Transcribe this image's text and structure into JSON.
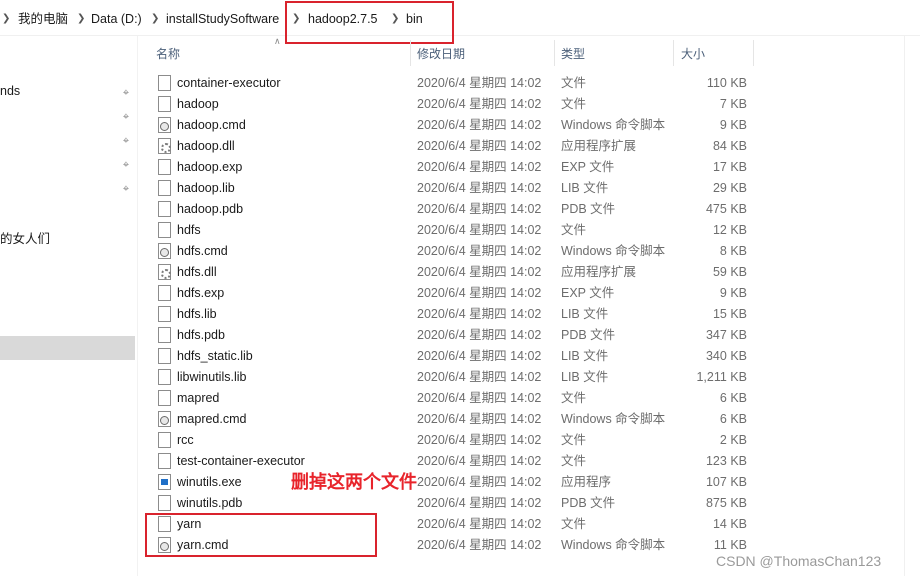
{
  "breadcrumb": [
    {
      "label": "我的电脑"
    },
    {
      "label": "Data (D:)"
    },
    {
      "label": "installStudySoftware"
    },
    {
      "label": "hadoop2.7.5"
    },
    {
      "label": "bin"
    }
  ],
  "sidebar": {
    "items": [
      {
        "label": "nds",
        "pinned": true
      },
      {
        "label": "",
        "pinned": true
      },
      {
        "label": "",
        "pinned": true
      },
      {
        "label": "",
        "pinned": true
      },
      {
        "label": "",
        "pinned": true
      },
      {
        "label": "的女人们",
        "pinned": false
      }
    ]
  },
  "columns": {
    "name": "名称",
    "date": "修改日期",
    "type": "类型",
    "size": "大小"
  },
  "files": [
    {
      "name": "container-executor",
      "date": "2020/6/4 星期四 14:02",
      "type": "文件",
      "size": "110 KB",
      "icon": "file-icon"
    },
    {
      "name": "hadoop",
      "date": "2020/6/4 星期四 14:02",
      "type": "文件",
      "size": "7 KB",
      "icon": "file-icon"
    },
    {
      "name": "hadoop.cmd",
      "date": "2020/6/4 星期四 14:02",
      "type": "Windows 命令脚本",
      "size": "9 KB",
      "icon": "cmd-file-icon"
    },
    {
      "name": "hadoop.dll",
      "date": "2020/6/4 星期四 14:02",
      "type": "应用程序扩展",
      "size": "84 KB",
      "icon": "dll-file-icon"
    },
    {
      "name": "hadoop.exp",
      "date": "2020/6/4 星期四 14:02",
      "type": "EXP 文件",
      "size": "17 KB",
      "icon": "file-icon"
    },
    {
      "name": "hadoop.lib",
      "date": "2020/6/4 星期四 14:02",
      "type": "LIB 文件",
      "size": "29 KB",
      "icon": "file-icon"
    },
    {
      "name": "hadoop.pdb",
      "date": "2020/6/4 星期四 14:02",
      "type": "PDB 文件",
      "size": "475 KB",
      "icon": "file-icon"
    },
    {
      "name": "hdfs",
      "date": "2020/6/4 星期四 14:02",
      "type": "文件",
      "size": "12 KB",
      "icon": "file-icon"
    },
    {
      "name": "hdfs.cmd",
      "date": "2020/6/4 星期四 14:02",
      "type": "Windows 命令脚本",
      "size": "8 KB",
      "icon": "cmd-file-icon"
    },
    {
      "name": "hdfs.dll",
      "date": "2020/6/4 星期四 14:02",
      "type": "应用程序扩展",
      "size": "59 KB",
      "icon": "dll-file-icon"
    },
    {
      "name": "hdfs.exp",
      "date": "2020/6/4 星期四 14:02",
      "type": "EXP 文件",
      "size": "9 KB",
      "icon": "file-icon"
    },
    {
      "name": "hdfs.lib",
      "date": "2020/6/4 星期四 14:02",
      "type": "LIB 文件",
      "size": "15 KB",
      "icon": "file-icon"
    },
    {
      "name": "hdfs.pdb",
      "date": "2020/6/4 星期四 14:02",
      "type": "PDB 文件",
      "size": "347 KB",
      "icon": "file-icon"
    },
    {
      "name": "hdfs_static.lib",
      "date": "2020/6/4 星期四 14:02",
      "type": "LIB 文件",
      "size": "340 KB",
      "icon": "file-icon"
    },
    {
      "name": "libwinutils.lib",
      "date": "2020/6/4 星期四 14:02",
      "type": "LIB 文件",
      "size": "1,211 KB",
      "icon": "file-icon"
    },
    {
      "name": "mapred",
      "date": "2020/6/4 星期四 14:02",
      "type": "文件",
      "size": "6 KB",
      "icon": "file-icon"
    },
    {
      "name": "mapred.cmd",
      "date": "2020/6/4 星期四 14:02",
      "type": "Windows 命令脚本",
      "size": "6 KB",
      "icon": "cmd-file-icon"
    },
    {
      "name": "rcc",
      "date": "2020/6/4 星期四 14:02",
      "type": "文件",
      "size": "2 KB",
      "icon": "file-icon"
    },
    {
      "name": "test-container-executor",
      "date": "2020/6/4 星期四 14:02",
      "type": "文件",
      "size": "123 KB",
      "icon": "file-icon"
    },
    {
      "name": "winutils.exe",
      "date": "2020/6/4 星期四 14:02",
      "type": "应用程序",
      "size": "107 KB",
      "icon": "exe-file-icon"
    },
    {
      "name": "winutils.pdb",
      "date": "2020/6/4 星期四 14:02",
      "type": "PDB 文件",
      "size": "875 KB",
      "icon": "file-icon"
    },
    {
      "name": "yarn",
      "date": "2020/6/4 星期四 14:02",
      "type": "文件",
      "size": "14 KB",
      "icon": "file-icon"
    },
    {
      "name": "yarn.cmd",
      "date": "2020/6/4 星期四 14:02",
      "type": "Windows 命令脚本",
      "size": "11 KB",
      "icon": "cmd-file-icon"
    }
  ],
  "annotation": {
    "text": "删掉这两个文件",
    "color": "#e8242b"
  },
  "watermark": "CSDN @ThomasChan123",
  "colors": {
    "highlight_box": "#d9232d",
    "header_text": "#4c607a",
    "selected_sidebar": "#d9d9d9"
  }
}
